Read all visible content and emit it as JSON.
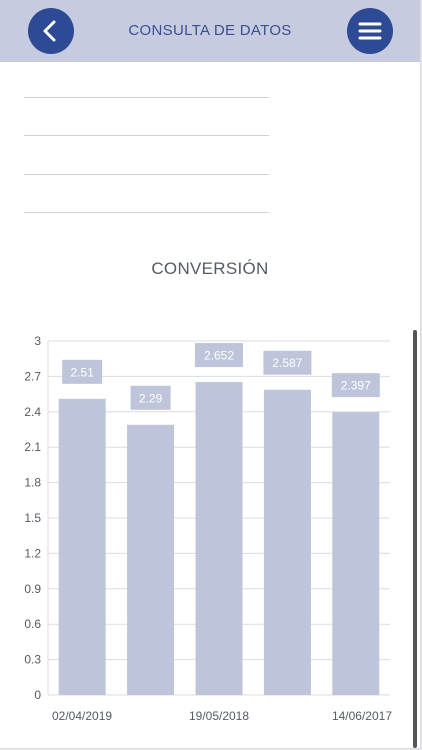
{
  "header": {
    "title": "CONSULTA DE DATOS",
    "back_icon": "chevron-left-icon",
    "menu_icon": "hamburger-menu-icon"
  },
  "colors": {
    "header_bg": "#c6cbdf",
    "button_bg": "#2f4a94",
    "title_text": "#3c4f92",
    "bar_fill": "#bec5da",
    "bar_label_text": "#ffffff"
  },
  "chart_data": {
    "type": "bar",
    "title": "CONVERSIÓN",
    "categories": [
      "02/04/2019",
      "",
      "19/05/2018",
      "",
      "14/06/2017"
    ],
    "values": [
      2.51,
      2.29,
      2.652,
      2.587,
      2.397
    ],
    "value_labels": [
      "2.51",
      "2.29",
      "2.652",
      "2.587",
      "2.397"
    ],
    "xtick_labels": [
      "02/04/2019",
      "19/05/2018",
      "14/06/2017"
    ],
    "ylim": [
      0,
      3
    ],
    "yticks": [
      0,
      0.3,
      0.6,
      0.9,
      1.2,
      1.5,
      1.8,
      2.1,
      2.4,
      2.7,
      3
    ],
    "ytick_labels": [
      "0",
      "0.3",
      "0.6",
      "0.9",
      "1.2",
      "1.5",
      "1.8",
      "2.1",
      "2.4",
      "2.7",
      "3"
    ],
    "grid": true,
    "legend": "none"
  }
}
